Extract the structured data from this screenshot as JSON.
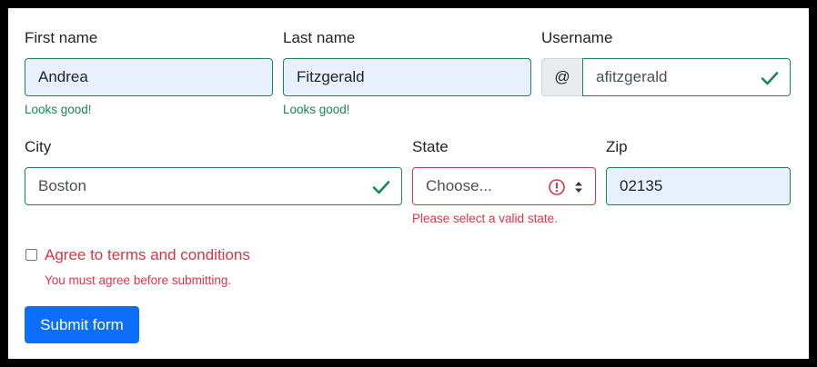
{
  "colors": {
    "valid": "#198754",
    "invalid": "#dc3545",
    "primary": "#0d6efd",
    "autofill": "#e8f0fe"
  },
  "first_name": {
    "label": "First name",
    "value": "Andrea",
    "feedback": "Looks good!"
  },
  "last_name": {
    "label": "Last name",
    "value": "Fitzgerald",
    "feedback": "Looks good!"
  },
  "username": {
    "label": "Username",
    "prefix": "@",
    "value": "afitzgerald",
    "icon": "check-icon"
  },
  "city": {
    "label": "City",
    "value": "Boston",
    "icon": "check-icon"
  },
  "state": {
    "label": "State",
    "selected": "Choose...",
    "feedback": "Please select a valid state.",
    "icon": "error-circle-icon"
  },
  "zip": {
    "label": "Zip",
    "value": "02135"
  },
  "terms": {
    "label": "Agree to terms and conditions",
    "checked": false,
    "feedback": "You must agree before submitting."
  },
  "submit": {
    "label": "Submit form"
  }
}
